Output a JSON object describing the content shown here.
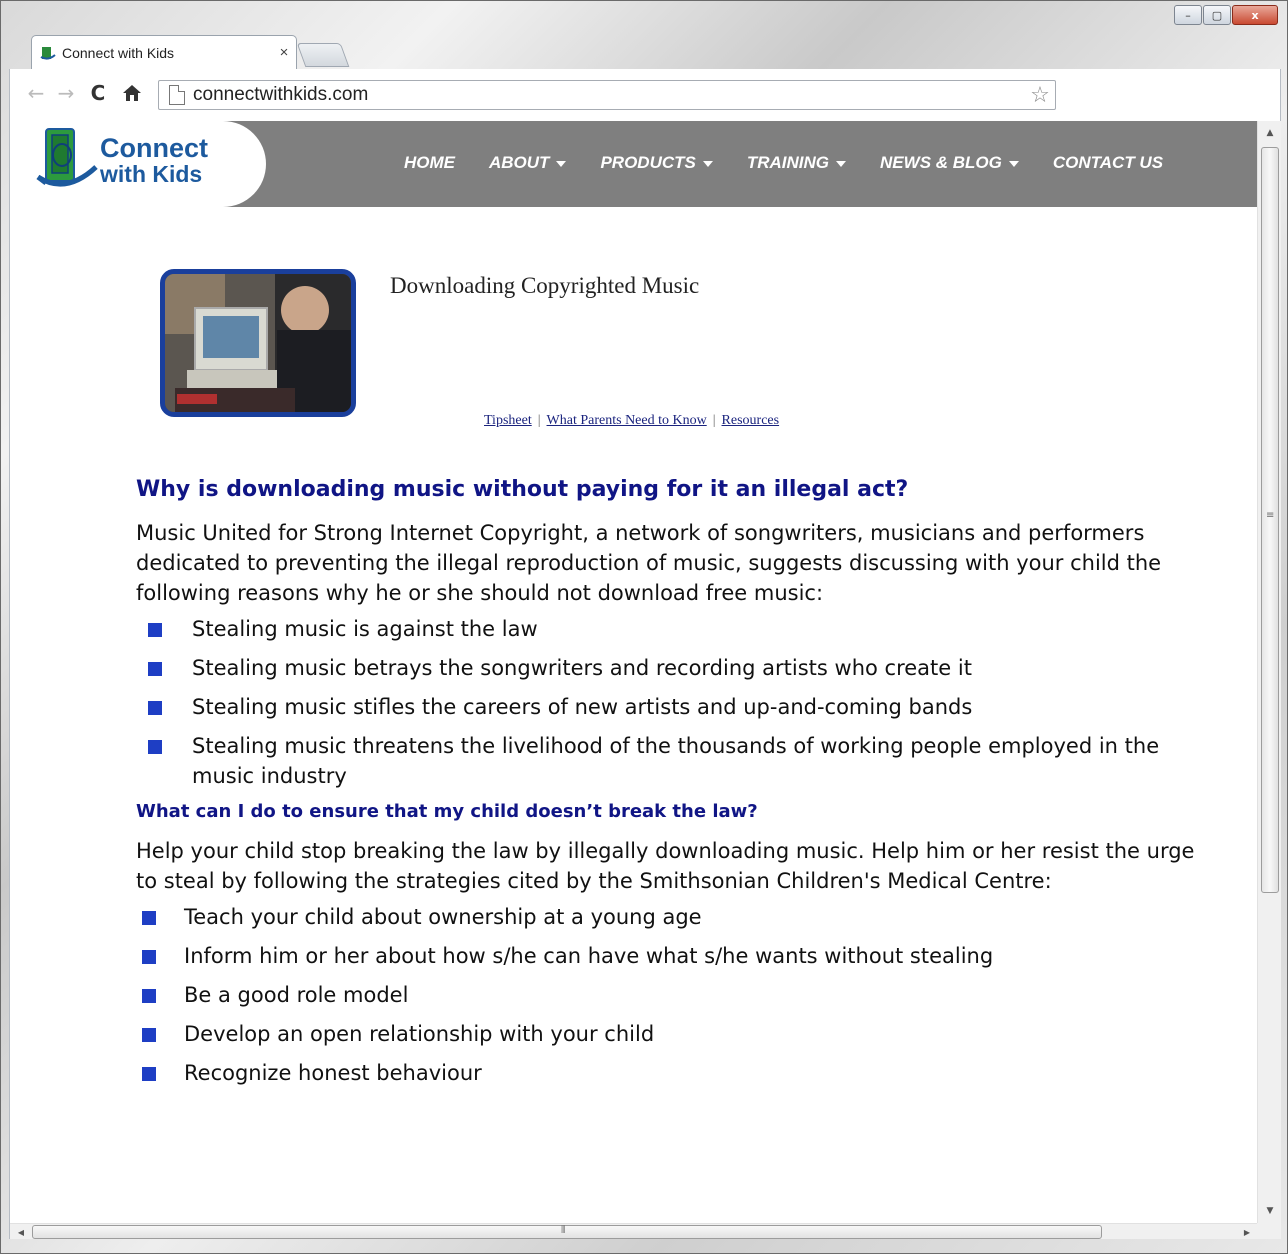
{
  "browser": {
    "tab_title": "Connect with Kids",
    "tab_close": "×",
    "url": "connectwithkids.com",
    "window_min": "–",
    "window_max": "▢",
    "window_close": "x"
  },
  "site": {
    "logo_line1": "Connect",
    "logo_line2": "with Kids",
    "nav": [
      {
        "label": "HOME",
        "dropdown": false
      },
      {
        "label": "ABOUT",
        "dropdown": true
      },
      {
        "label": "PRODUCTS",
        "dropdown": true
      },
      {
        "label": "TRAINING",
        "dropdown": true
      },
      {
        "label": "NEWS & BLOG",
        "dropdown": true
      },
      {
        "label": "CONTACT US",
        "dropdown": false
      }
    ]
  },
  "article": {
    "title": "Downloading Copyrighted Music",
    "links": [
      "Tipsheet",
      "What Parents Need to Know",
      "Resources"
    ],
    "link_separator": "|",
    "heading1": "Why is downloading music without paying for it an illegal act?",
    "para1": "Music United for Strong Internet Copyright, a network of songwriters, musicians and performers dedicated to preventing the illegal reproduction of music, suggests discussing with your child the following reasons why he or she should not download free music:",
    "reasons": [
      "Stealing music is against the law",
      "Stealing music betrays the songwriters and recording artists who create it",
      "Stealing music stifles the careers of new artists and up-and-coming bands",
      "Stealing music threatens the livelihood of the thousands of working people employed in the music industry"
    ],
    "heading2": "What can I do to ensure that my child doesn’t break the law?",
    "para2": "Help your child stop breaking the law by illegally downloading music. Help him or her resist the urge to steal by following the strategies cited by the Smithsonian Children's Medical Centre:",
    "strategies": [
      "Teach your child about ownership at a young age",
      "Inform him or her about how s/he can have what s/he wants without stealing",
      "Be a good role model",
      "Develop an open relationship with your child",
      "Recognize honest behaviour"
    ]
  },
  "colors": {
    "header_bg": "#7f7f7f",
    "heading": "#101585",
    "bullet": "#1e3ec4",
    "image_border": "#1a3f9c",
    "logo_blue": "#1d5a9e"
  }
}
